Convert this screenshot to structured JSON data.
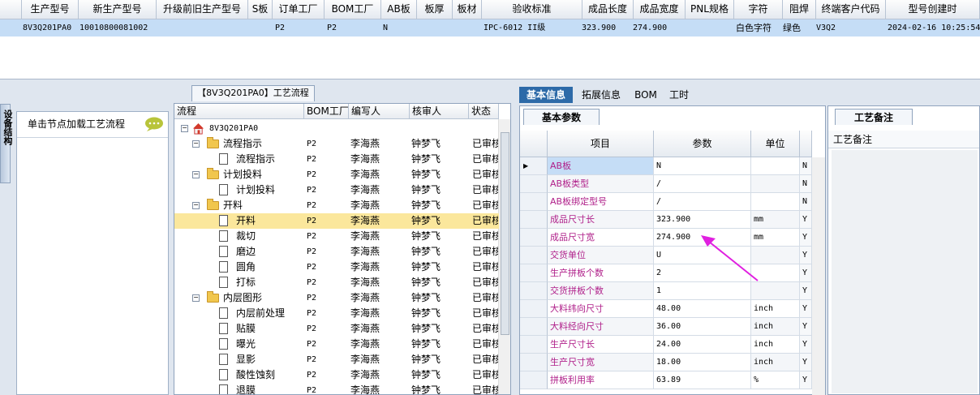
{
  "top_grid": {
    "columns": [
      "生产型号",
      "新生产型号",
      "升级前旧生产型号",
      "S板",
      "订单工厂",
      "BOM工厂",
      "AB板",
      "板厚",
      "板材",
      "验收标准",
      "成品长度",
      "成品宽度",
      "PNL规格",
      "字符",
      "阻焊",
      "终端客户代码",
      "型号创建时"
    ],
    "row": {
      "prod_model": "8V3Q201PA0",
      "new_model": "10010800081002",
      "old_model": "",
      "s_board": "",
      "order_factory": "P2",
      "bom_factory": "P2",
      "ab_board": "N",
      "thickness": "",
      "material": "",
      "standard": "IPC-6012 II级",
      "length": "323.900",
      "width": "274.900",
      "pnl": "",
      "char": "白色字符",
      "mask": "绿色",
      "customer": "V3Q2",
      "created": "2024-02-16 10:25:54"
    }
  },
  "left": {
    "side_tab": "设备结构",
    "node_hint": "单击节点加载工艺流程",
    "flow_tab": "【8V3Q201PA0】工艺流程"
  },
  "tree": {
    "columns": [
      "流程",
      "BOM工厂",
      "编写人",
      "核审人",
      "状态"
    ],
    "root": "8V3Q201PA0",
    "rows": [
      {
        "label": "流程指示",
        "bom": "P2",
        "writer": "李海燕",
        "checker": "钟梦飞",
        "status": "已审核",
        "type": "folder"
      },
      {
        "label": "流程指示",
        "bom": "P2",
        "writer": "李海燕",
        "checker": "钟梦飞",
        "status": "已审核",
        "type": "doc"
      },
      {
        "label": "计划投料",
        "bom": "P2",
        "writer": "李海燕",
        "checker": "钟梦飞",
        "status": "已审核",
        "type": "folder"
      },
      {
        "label": "计划投料",
        "bom": "P2",
        "writer": "李海燕",
        "checker": "钟梦飞",
        "status": "已审核",
        "type": "doc"
      },
      {
        "label": "开料",
        "bom": "P2",
        "writer": "李海燕",
        "checker": "钟梦飞",
        "status": "已审核",
        "type": "folder"
      },
      {
        "label": "开料",
        "bom": "P2",
        "writer": "李海燕",
        "checker": "钟梦飞",
        "status": "已审核",
        "type": "doc"
      },
      {
        "label": "裁切",
        "bom": "P2",
        "writer": "李海燕",
        "checker": "钟梦飞",
        "status": "已审核",
        "type": "doc"
      },
      {
        "label": "磨边",
        "bom": "P2",
        "writer": "李海燕",
        "checker": "钟梦飞",
        "status": "已审核",
        "type": "doc"
      },
      {
        "label": "圆角",
        "bom": "P2",
        "writer": "李海燕",
        "checker": "钟梦飞",
        "status": "已审核",
        "type": "doc"
      },
      {
        "label": "打标",
        "bom": "P2",
        "writer": "李海燕",
        "checker": "钟梦飞",
        "status": "已审核",
        "type": "doc"
      },
      {
        "label": "内层图形",
        "bom": "P2",
        "writer": "李海燕",
        "checker": "钟梦飞",
        "status": "已审核",
        "type": "folder"
      },
      {
        "label": "内层前处理",
        "bom": "P2",
        "writer": "李海燕",
        "checker": "钟梦飞",
        "status": "已审核",
        "type": "doc"
      },
      {
        "label": "贴膜",
        "bom": "P2",
        "writer": "李海燕",
        "checker": "钟梦飞",
        "status": "已审核",
        "type": "doc"
      },
      {
        "label": "曝光",
        "bom": "P2",
        "writer": "李海燕",
        "checker": "钟梦飞",
        "status": "已审核",
        "type": "doc"
      },
      {
        "label": "显影",
        "bom": "P2",
        "writer": "李海燕",
        "checker": "钟梦飞",
        "status": "已审核",
        "type": "doc"
      },
      {
        "label": "酸性蚀刻",
        "bom": "P2",
        "writer": "李海燕",
        "checker": "钟梦飞",
        "status": "已审核",
        "type": "doc"
      },
      {
        "label": "退膜",
        "bom": "P2",
        "writer": "李海燕",
        "checker": "钟梦飞",
        "status": "已审核",
        "type": "doc"
      }
    ]
  },
  "right": {
    "tabs": [
      "基本信息",
      "拓展信息",
      "BOM",
      "工时"
    ],
    "basic_tab": "基本参数",
    "param_columns": [
      "项目",
      "参数",
      "单位"
    ],
    "params": [
      {
        "name": "AB板",
        "value": "N",
        "unit": "",
        "flag": "N"
      },
      {
        "name": "AB板类型",
        "value": "/",
        "unit": "",
        "flag": "N"
      },
      {
        "name": "AB板绑定型号",
        "value": "/",
        "unit": "",
        "flag": "N"
      },
      {
        "name": "成品尺寸长",
        "value": "323.900",
        "unit": "mm",
        "flag": "Y"
      },
      {
        "name": "成品尺寸宽",
        "value": "274.900",
        "unit": "mm",
        "flag": "Y"
      },
      {
        "name": "交货单位",
        "value": "U",
        "unit": "",
        "flag": "Y"
      },
      {
        "name": "生产拼板个数",
        "value": "2",
        "unit": "",
        "flag": "Y"
      },
      {
        "name": "交货拼板个数",
        "value": "1",
        "unit": "",
        "flag": "Y"
      },
      {
        "name": "大料纬向尺寸",
        "value": "48.00",
        "unit": "inch",
        "flag": "Y"
      },
      {
        "name": "大料经向尺寸",
        "value": "36.00",
        "unit": "inch",
        "flag": "Y"
      },
      {
        "name": "生产尺寸长",
        "value": "24.00",
        "unit": "inch",
        "flag": "Y"
      },
      {
        "name": "生产尺寸宽",
        "value": "18.00",
        "unit": "inch",
        "flag": "Y"
      },
      {
        "name": "拼板利用率",
        "value": "63.89",
        "unit": "%",
        "flag": "Y"
      }
    ],
    "remarks_tab": "工艺备注",
    "remarks_label": "工艺备注"
  },
  "colors": {
    "selected_row": "#c5ddf6",
    "tree_selected": "#fbe79c",
    "param_name": "#b0208a",
    "tab_active": "#2d6aa8",
    "arrow": "#e020e0"
  }
}
